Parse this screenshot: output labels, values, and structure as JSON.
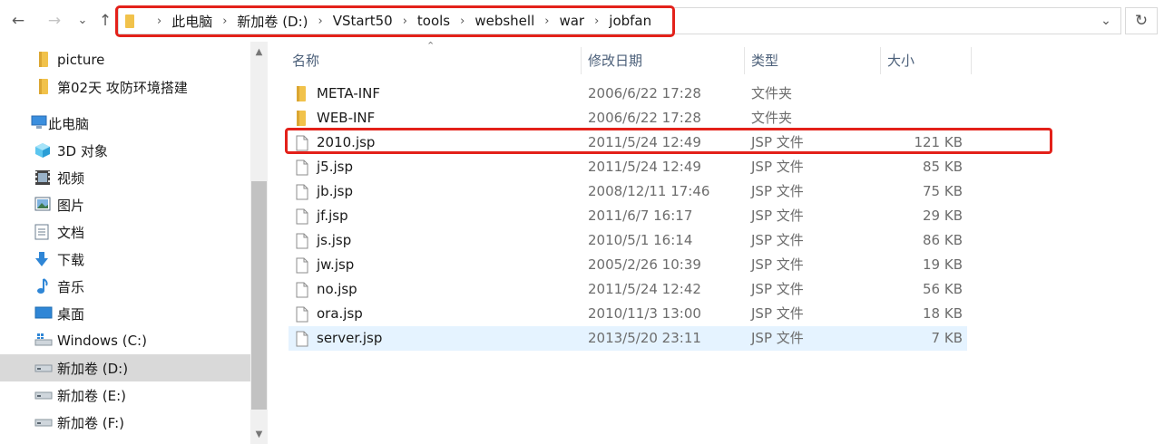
{
  "breadcrumb": [
    "此电脑",
    "新加卷 (D:)",
    "VStart50",
    "tools",
    "webshell",
    "war",
    "jobfan"
  ],
  "nav": {
    "back_icon": "←",
    "forward_icon": "→",
    "recent_icon": "⌄",
    "up_icon": "↑",
    "dropdown_icon": "⌄",
    "refresh_icon": "↻"
  },
  "sidebar": {
    "items": [
      {
        "label": "picture",
        "icon": "folder-icon"
      },
      {
        "label": "第02天 攻防环境搭建",
        "icon": "folder-icon"
      },
      {
        "label": "此电脑",
        "icon": "computer-icon"
      },
      {
        "label": "3D 对象",
        "icon": "3d-objects-icon"
      },
      {
        "label": "视频",
        "icon": "video-icon"
      },
      {
        "label": "图片",
        "icon": "pictures-icon"
      },
      {
        "label": "文档",
        "icon": "documents-icon"
      },
      {
        "label": "下载",
        "icon": "download-icon"
      },
      {
        "label": "音乐",
        "icon": "music-icon"
      },
      {
        "label": "桌面",
        "icon": "desktop-icon"
      },
      {
        "label": "Windows (C:)",
        "icon": "system-drive-icon"
      },
      {
        "label": "新加卷 (D:)",
        "icon": "drive-icon"
      },
      {
        "label": "新加卷 (E:)",
        "icon": "drive-icon"
      },
      {
        "label": "新加卷 (F:)",
        "icon": "drive-icon"
      }
    ]
  },
  "columns": {
    "name": "名称",
    "date": "修改日期",
    "type": "类型",
    "size": "大小"
  },
  "files": [
    {
      "name": "META-INF",
      "date": "2006/6/22 17:28",
      "type": "文件夹",
      "size": "",
      "kind": "folder"
    },
    {
      "name": "WEB-INF",
      "date": "2006/6/22 17:28",
      "type": "文件夹",
      "size": "",
      "kind": "folder"
    },
    {
      "name": "2010.jsp",
      "date": "2011/5/24 12:49",
      "type": "JSP 文件",
      "size": "121 KB",
      "kind": "file"
    },
    {
      "name": "j5.jsp",
      "date": "2011/5/24 12:49",
      "type": "JSP 文件",
      "size": "85 KB",
      "kind": "file"
    },
    {
      "name": "jb.jsp",
      "date": "2008/12/11 17:46",
      "type": "JSP 文件",
      "size": "75 KB",
      "kind": "file"
    },
    {
      "name": "jf.jsp",
      "date": "2011/6/7 16:17",
      "type": "JSP 文件",
      "size": "29 KB",
      "kind": "file"
    },
    {
      "name": "js.jsp",
      "date": "2010/5/1 16:14",
      "type": "JSP 文件",
      "size": "86 KB",
      "kind": "file"
    },
    {
      "name": "jw.jsp",
      "date": "2005/2/26 10:39",
      "type": "JSP 文件",
      "size": "19 KB",
      "kind": "file"
    },
    {
      "name": "no.jsp",
      "date": "2011/5/24 12:42",
      "type": "JSP 文件",
      "size": "56 KB",
      "kind": "file"
    },
    {
      "name": "ora.jsp",
      "date": "2010/11/3 13:00",
      "type": "JSP 文件",
      "size": "18 KB",
      "kind": "file"
    },
    {
      "name": "server.jsp",
      "date": "2013/5/20 23:11",
      "type": "JSP 文件",
      "size": "7 KB",
      "kind": "file"
    }
  ],
  "colors": {
    "highlight": "#e3211a",
    "selected_row": "#e5f3ff",
    "selected_nav": "#d9d9d9",
    "folder": "#f1c24b"
  }
}
